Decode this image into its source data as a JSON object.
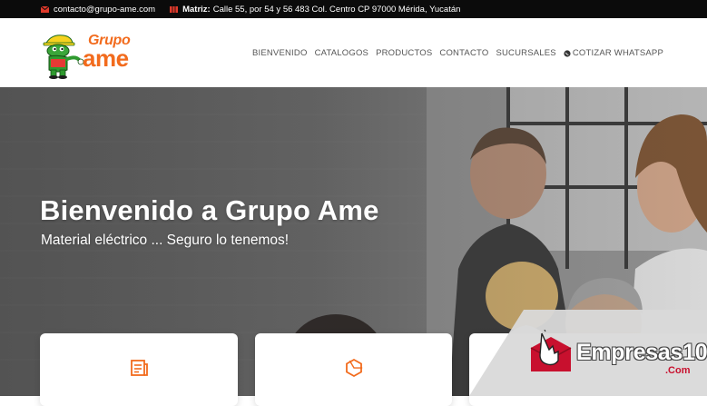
{
  "topbar": {
    "email": "contacto@grupo-ame.com",
    "address_label": "Matriz:",
    "address": "Calle 55, por 54 y 56 483 Col. Centro CP 97000 Mérida, Yucatán"
  },
  "logo": {
    "line1": "Grupo",
    "line2": "ame"
  },
  "nav": {
    "items": [
      "BIENVENIDO",
      "CATALOGOS",
      "PRODUCTOS",
      "CONTACTO",
      "SUCURSALES",
      "COTIZAR WHATSAPP"
    ]
  },
  "hero": {
    "title": "Bienvenido a Grupo Ame",
    "subtitle": "Material eléctrico ... Seguro lo tenemos!"
  },
  "cards": {
    "icons": [
      "document-icon",
      "hexagon-icon"
    ]
  },
  "watermark": {
    "brand": "Empresas10",
    "suffix": ".Com"
  },
  "colors": {
    "accent": "#f26b1d",
    "topbar_bg": "#0b0b0b",
    "watermark_red": "#c8102e"
  }
}
